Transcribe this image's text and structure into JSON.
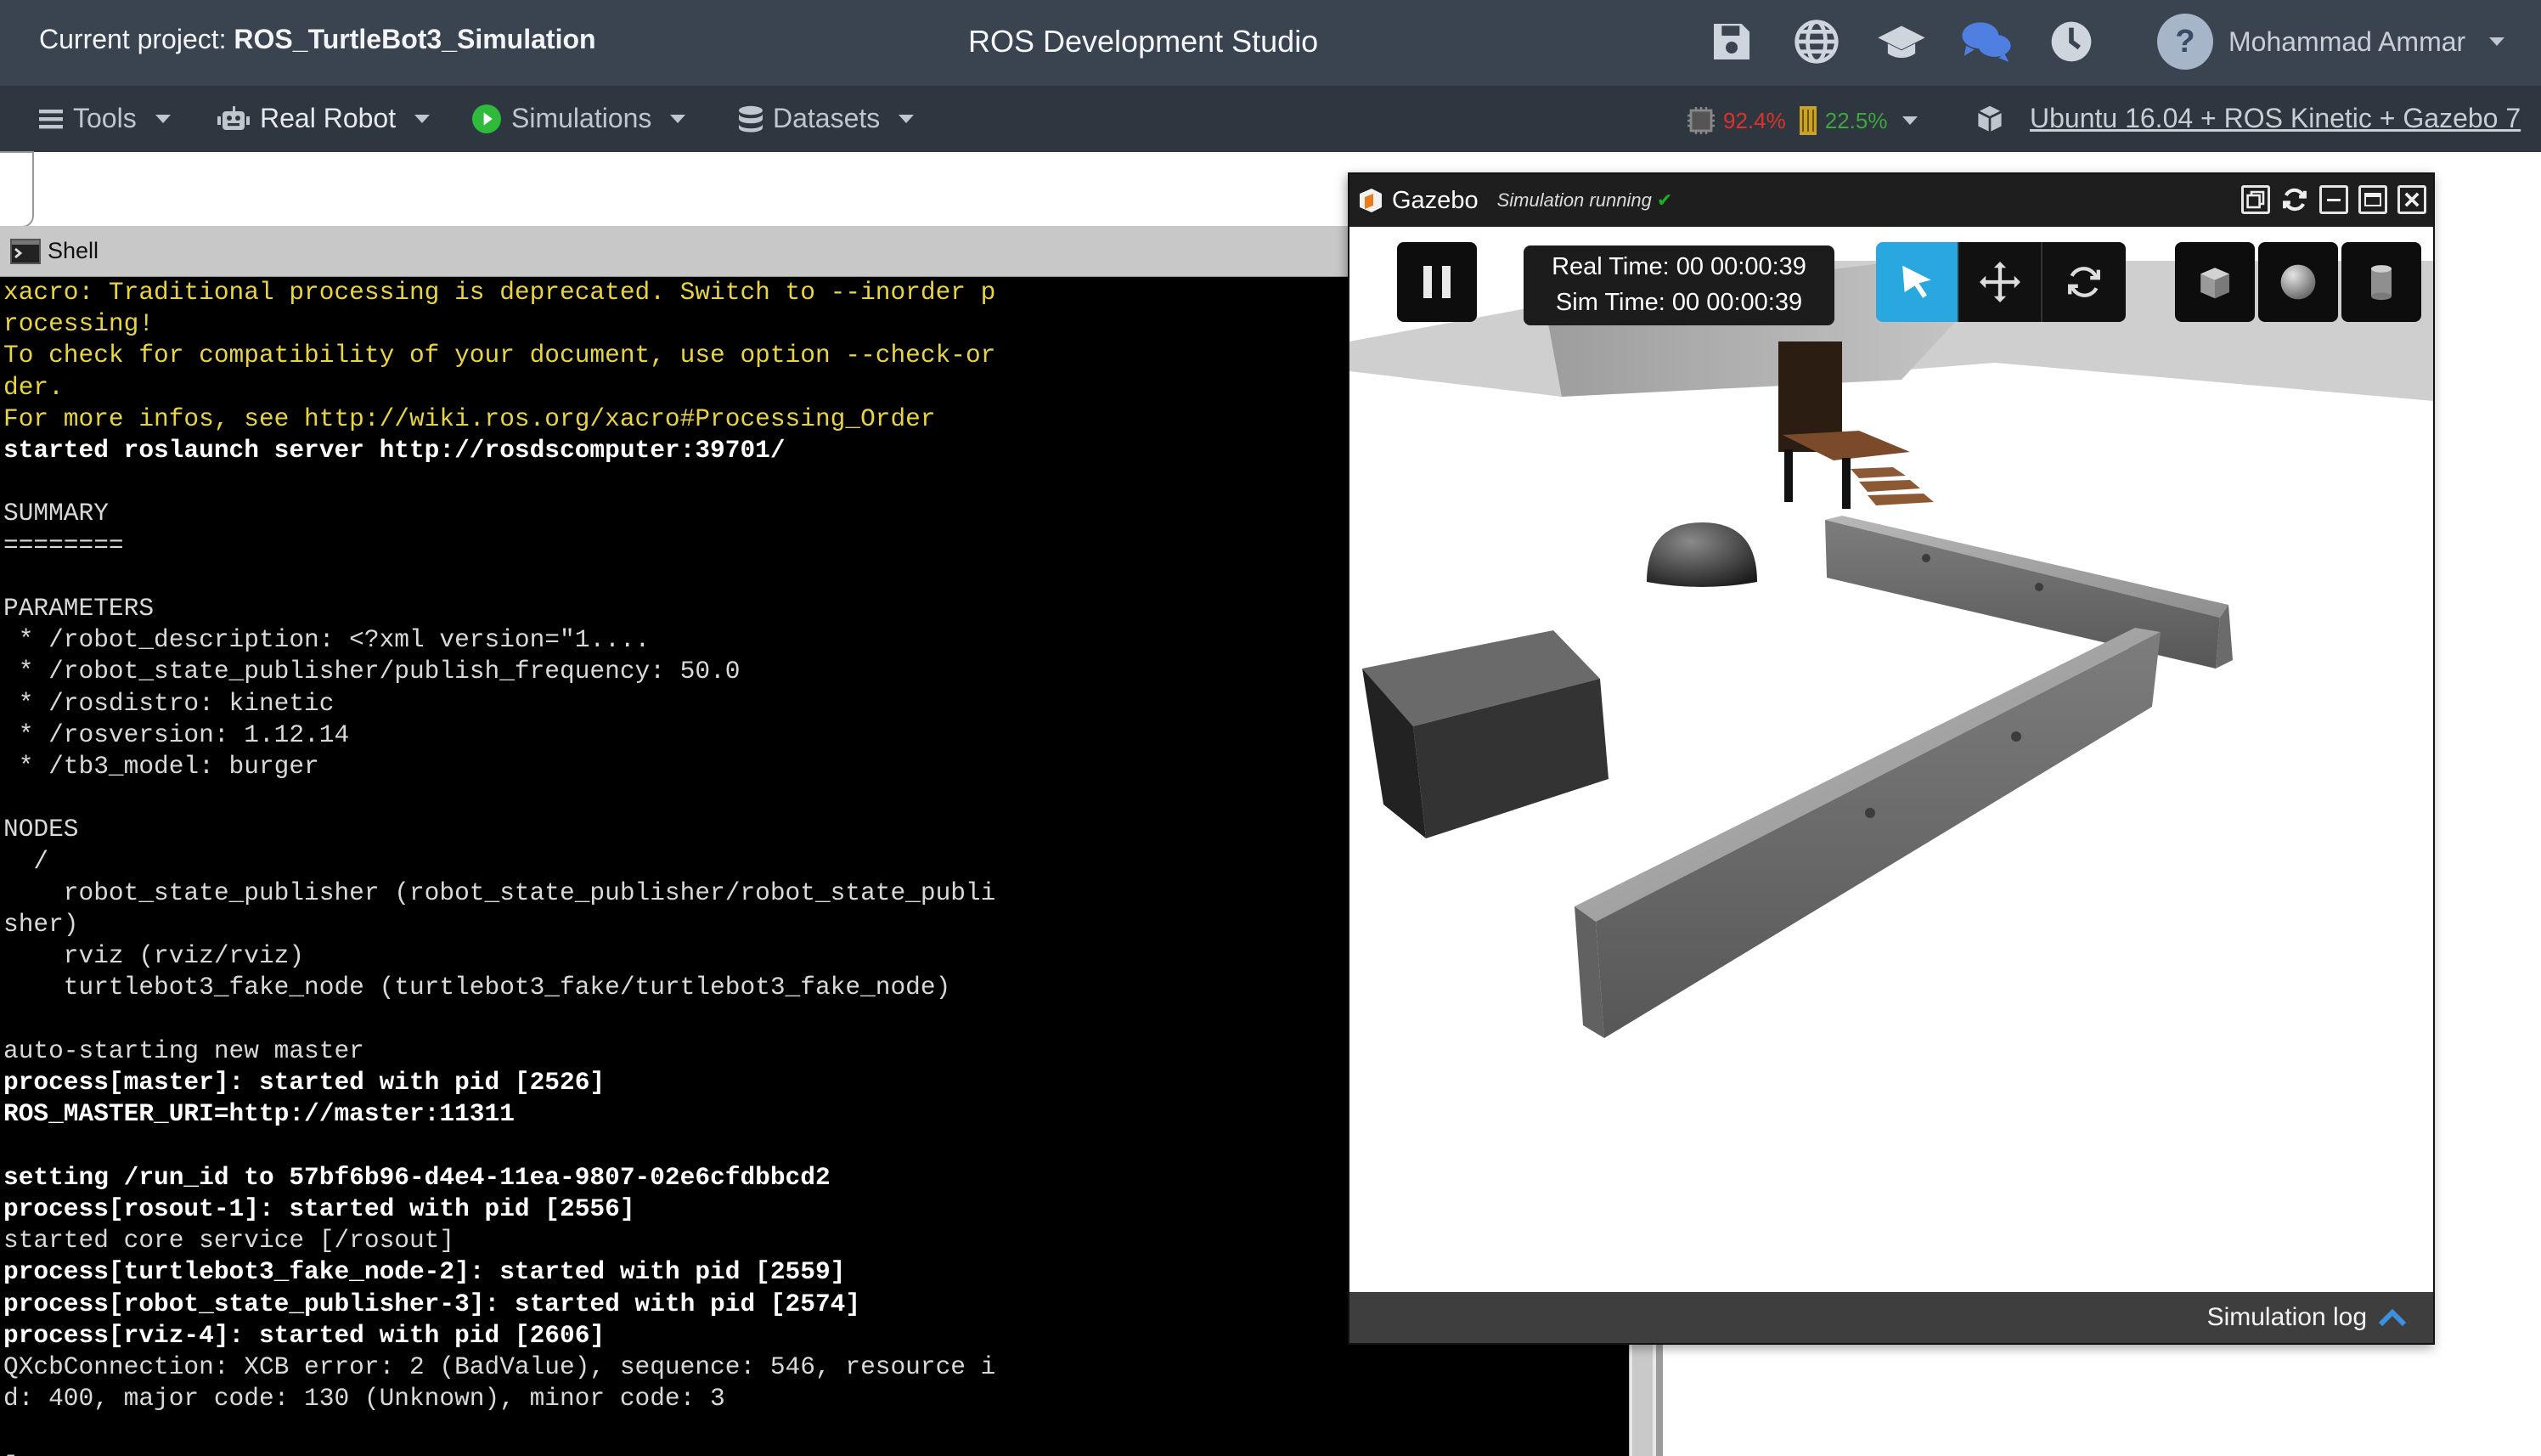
{
  "header": {
    "project_prefix": "Current project:",
    "project_name": "ROS_TurtleBot3_Simulation",
    "app_title": "ROS Development Studio",
    "icons": [
      "save-icon",
      "globe-icon",
      "graduation-cap-icon",
      "chat-icon",
      "clock-icon"
    ],
    "user": {
      "avatar_text": "?",
      "name": "Mohammad Ammar"
    }
  },
  "menubar": {
    "tools": "Tools",
    "real_robot": "Real Robot",
    "simulations": "Simulations",
    "datasets": "Datasets",
    "cpu": "92.4%",
    "memory": "22.5%",
    "environment": "Ubuntu 16.04 + ROS Kinetic + Gazebo 7"
  },
  "colors": {
    "accent": "#29a8e0",
    "cpu": "#e0312c",
    "memory": "#3fa63f",
    "terminal_yellow": "#e8d443"
  },
  "shell": {
    "title": "Shell",
    "lines": [
      {
        "t": "xacro: Traditional processing is deprecated. Switch to --inorder p",
        "c": "y"
      },
      {
        "t": "rocessing!",
        "c": "y"
      },
      {
        "t": "To check for compatibility of your document, use option --check-or",
        "c": "y"
      },
      {
        "t": "der.",
        "c": "y"
      },
      {
        "t": "For more infos, see http://wiki.ros.org/xacro#Processing_Order",
        "c": "y"
      },
      {
        "t": "started roslaunch server http://rosdscomputer:39701/",
        "c": "b"
      },
      {
        "t": "",
        "c": "n"
      },
      {
        "t": "SUMMARY",
        "c": "n"
      },
      {
        "t": "========",
        "c": "n"
      },
      {
        "t": "",
        "c": "n"
      },
      {
        "t": "PARAMETERS",
        "c": "n"
      },
      {
        "t": " * /robot_description: <?xml version=\"1....",
        "c": "n"
      },
      {
        "t": " * /robot_state_publisher/publish_frequency: 50.0",
        "c": "n"
      },
      {
        "t": " * /rosdistro: kinetic",
        "c": "n"
      },
      {
        "t": " * /rosversion: 1.12.14",
        "c": "n"
      },
      {
        "t": " * /tb3_model: burger",
        "c": "n"
      },
      {
        "t": "",
        "c": "n"
      },
      {
        "t": "NODES",
        "c": "n"
      },
      {
        "t": "  /",
        "c": "n"
      },
      {
        "t": "    robot_state_publisher (robot_state_publisher/robot_state_publi",
        "c": "n"
      },
      {
        "t": "sher)",
        "c": "n"
      },
      {
        "t": "    rviz (rviz/rviz)",
        "c": "n"
      },
      {
        "t": "    turtlebot3_fake_node (turtlebot3_fake/turtlebot3_fake_node)",
        "c": "n"
      },
      {
        "t": "",
        "c": "n"
      },
      {
        "t": "auto-starting new master",
        "c": "n"
      },
      {
        "t": "process[master]: started with pid [2526]",
        "c": "b"
      },
      {
        "t": "ROS_MASTER_URI=http://master:11311",
        "c": "b"
      },
      {
        "t": "",
        "c": "n"
      },
      {
        "t": "setting /run_id to 57bf6b96-d4e4-11ea-9807-02e6cfdbbcd2",
        "c": "b"
      },
      {
        "t": "process[rosout-1]: started with pid [2556]",
        "c": "b"
      },
      {
        "t": "started core service [/rosout]",
        "c": "n"
      },
      {
        "t": "process[turtlebot3_fake_node-2]: started with pid [2559]",
        "c": "b"
      },
      {
        "t": "process[robot_state_publisher-3]: started with pid [2574]",
        "c": "b"
      },
      {
        "t": "process[rviz-4]: started with pid [2606]",
        "c": "b"
      },
      {
        "t": "QXcbConnection: XCB error: 2 (BadValue), sequence: 546, resource i",
        "c": "n"
      },
      {
        "t": "d: 400, major code: 130 (Unknown), minor code: 3",
        "c": "n"
      },
      {
        "t": "",
        "c": "n"
      },
      {
        "t": "▯",
        "c": "n"
      }
    ]
  },
  "gazebo": {
    "title": "Gazebo",
    "status": "Simulation running",
    "real_time": "Real Time: 00 00:00:39",
    "sim_time": "Sim Time: 00 00:00:39",
    "log_label": "Simulation log"
  }
}
